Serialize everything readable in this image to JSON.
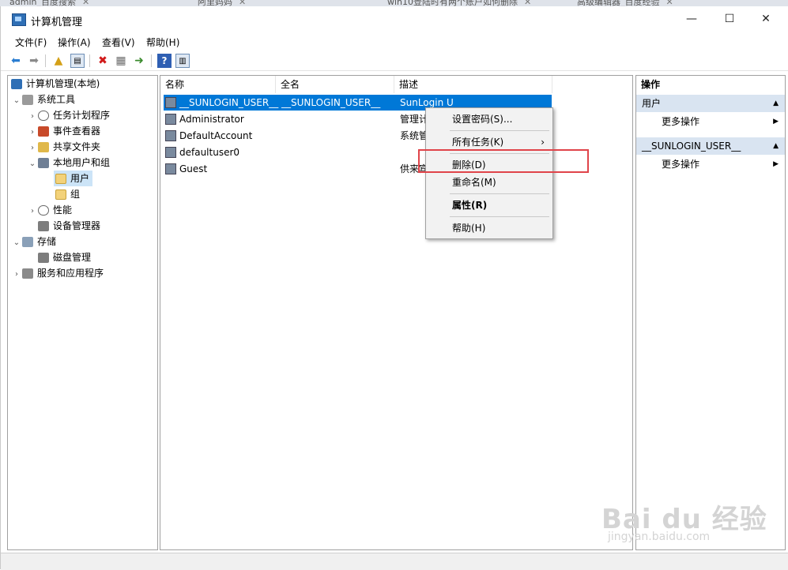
{
  "browser_tabs": [
    {
      "label": "admin_百度搜索"
    },
    {
      "label": "阿里妈妈"
    },
    {
      "label": "win10登陆时有两个账户如何删除"
    },
    {
      "label": "高级编辑器_百度经验"
    }
  ],
  "window": {
    "title": "计算机管理",
    "minimize": "—",
    "maximize": "☐",
    "close": "✕"
  },
  "menu": [
    "文件(F)",
    "操作(A)",
    "查看(V)",
    "帮助(H)"
  ],
  "toolbar_icons": [
    "back-icon",
    "forward-icon",
    "up-folder-icon",
    "show-hide-tree-icon",
    "delete-icon",
    "properties-icon",
    "export-icon",
    "help-icon",
    "view-icon"
  ],
  "tree": [
    {
      "label": "计算机管理(本地)",
      "level": 0,
      "arrow": ""
    },
    {
      "label": "系统工具",
      "level": 1,
      "arrow": "⌄"
    },
    {
      "label": "任务计划程序",
      "level": 2,
      "arrow": "›"
    },
    {
      "label": "事件查看器",
      "level": 2,
      "arrow": "›"
    },
    {
      "label": "共享文件夹",
      "level": 2,
      "arrow": "›"
    },
    {
      "label": "本地用户和组",
      "level": 2,
      "arrow": "⌄"
    },
    {
      "label": "用户",
      "level": 3,
      "arrow": "",
      "selected": true
    },
    {
      "label": "组",
      "level": 3,
      "arrow": ""
    },
    {
      "label": "性能",
      "level": 2,
      "arrow": "›"
    },
    {
      "label": "设备管理器",
      "level": 2,
      "arrow": ""
    },
    {
      "label": "存储",
      "level": 1,
      "arrow": "⌄"
    },
    {
      "label": "磁盘管理",
      "level": 2,
      "arrow": ""
    },
    {
      "label": "服务和应用程序",
      "level": 1,
      "arrow": "›"
    }
  ],
  "columns": [
    "名称",
    "全名",
    "描述"
  ],
  "users": [
    {
      "name": "__SUNLOGIN_USER__",
      "fullname": "__SUNLOGIN_USER__",
      "desc": "SunLogin U",
      "selected": true
    },
    {
      "name": "Administrator",
      "fullname": "",
      "desc": "管理计"
    },
    {
      "name": "DefaultAccount",
      "fullname": "",
      "desc": "系统管"
    },
    {
      "name": "defaultuser0",
      "fullname": "",
      "desc": ""
    },
    {
      "name": "Guest",
      "fullname": "",
      "desc": "供来宾"
    }
  ],
  "context_menu": {
    "set_password": "设置密码(S)...",
    "all_tasks": "所有任务(K)",
    "delete": "删除(D)",
    "rename": "重命名(M)",
    "properties": "属性(R)",
    "help": "帮助(H)"
  },
  "actions": {
    "header": "操作",
    "section1": "用户",
    "more1": "更多操作",
    "section2": "__SUNLOGIN_USER__",
    "more2": "更多操作"
  },
  "watermark": {
    "brand": "Bai du 经验",
    "url": "jingyan.baidu.com"
  },
  "colors": {
    "selection": "#0078d7",
    "accent_section": "#d9e4f1",
    "highlight_box": "#e0444a"
  }
}
